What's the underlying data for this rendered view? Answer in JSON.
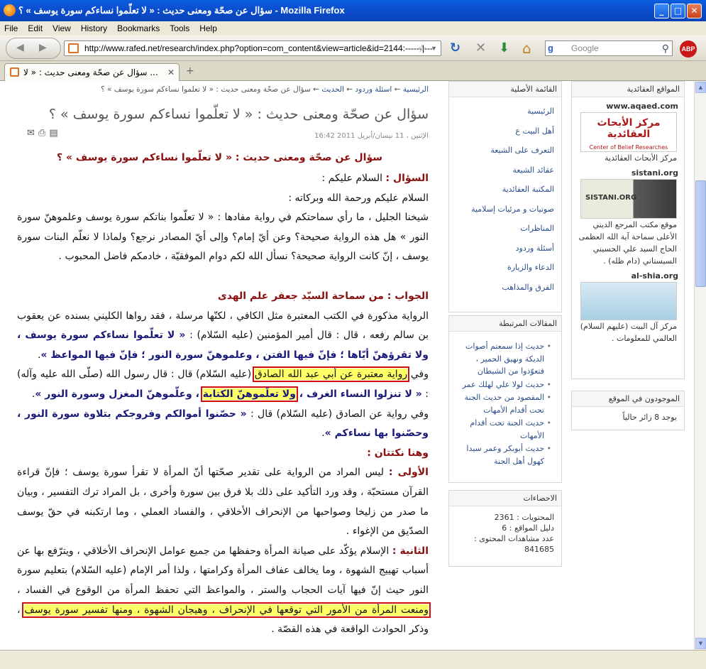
{
  "window": {
    "title": "سؤال عن صحّة ومعنى حديث : « لا تعلّموا نساءكم سورة يوسف » ؟ - Mozilla Firefox",
    "minimize": "_",
    "maximize": "□",
    "close": "✕"
  },
  "menu": [
    "File",
    "Edit",
    "View",
    "History",
    "Bookmarks",
    "Tools",
    "Help"
  ],
  "toolbar": {
    "back_icon": "◀",
    "forward_icon": "▶",
    "url": "http://www.rafed.net/research/index.php?option=com_content&view=article&id=2144:------|---",
    "star_icon": "☆",
    "dropdown_icon": "▼",
    "reload_icon": "↻",
    "stop_icon": "✕",
    "download_icon": "⬇",
    "home_icon": "⌂",
    "search_engine_icon": "g",
    "search_placeholder": "Google",
    "search_icon": "⚲",
    "abp_label": "ABP"
  },
  "tabs": {
    "active_label": "سؤال عن صحّة ومعنى حديث : « لا ...",
    "close_icon": "✕",
    "new_tab_icon": "+"
  },
  "breadcrumb": {
    "home": "الرئيسية",
    "sep": " ← ",
    "c1": "اسئلة وردود",
    "c2": "الحديث",
    "current": "سؤال عن صحّة ومعنى حديث : « لا تعلّموا نساءكم سورة يوسف » ؟"
  },
  "article": {
    "title": "سؤال عن صحّة ومعنى حديث : « لا تعلّموا نساءكم سورة يوسف » ؟",
    "date": "الإثنين ، 11 نيسان/أبريل 2011 16:42",
    "email_icon": "✉",
    "print_icon": "⎙",
    "pdf_icon": "▤",
    "heading": "سؤال عن صحّة ومعنى حديث : « لا تعلّموا نساءكم سورة يوسف » ؟",
    "q_label": "السؤال :",
    "q_greeting": " السلام عليكم :",
    "q_greeting2": "السلام عليكم ورحمة الله وبركاته :",
    "q_body": "شيخنا الجليل ، ما رأي سماحتكم في رواية مفادها : « لا تعلّموا بناتكم سورة يوسف وعلموهنّ سورة النور » هل هذه الرواية صحيحة؟ وعن أيّ إمام؟ وإلى أيّ المصادر نرجع؟ ولماذا لا نعلّم البنات سورة يوسف ، إنّ كانت الرواية صحيحة؟ نسأل الله لكم دوام الموفقيّة ، خادمكم فاضل المحبوب .",
    "a_label": "الجواب : من سماحة السيّد جعفر علم الهدى",
    "p1a": "الرواية مذكورة في الكتب المعتبرة مثل الكافي ، لكنّها مرسلة ، فقد رواها الكليني بسنده عن يعقوب بن سالم رفعه ، قال : قال أمير المؤمنين (عليه السّلام) : ",
    "p1b": "« لا تعلّموا نساءكم سورة يوسف ، ولا تقرؤهنّ أيّاها ؛ فإنّ فيها الفتن ، وعلموهنّ سورة النور ؛ فإنّ فيها المواعظ »",
    "p1c": ".",
    "p2a": "وفي ",
    "p2hl": "رواية معتبرة عن أبي عبد الله الصادق",
    "p2b": " (عليه السّلام) قال : قال رسول الله (صلّى الله عليه وآله) : ",
    "p2c": "« لا تنزلوا النساء الغرف ، ",
    "p2hl2": "ولا تعلّموهنّ الكتابة",
    "p2d": " ، وعلّموهنّ المغزل وسورة النور »",
    "p2e": ".",
    "p3a": "وفي رواية عن الصادق (عليه السّلام) قال : ",
    "p3b": "« حصّنوا أموالكم وفروجكم بتلاوة سورة النور ، وحصّنوا بها نساءكم »",
    "p3c": ".",
    "points_label": "وهنا نكتتان :",
    "first_label": "الأولى :",
    "first_body": " ليس المراد من الرواية على تقدير صحّتها أنّ المرأة لا تقرأ سورة يوسف ؛ فإنّ قراءة القرآن مستحبّة ، وقد ورد التأكيد على ذلك بلا فرق بين سورة وأخرى ، بل المراد ترك التفسير ، وبيان ما صدر من زليخا وصواحبها من الإنحراف الأخلاقي ، والفساد العملي ، وما ارتكبنه في حقّ يوسف الصدّيق من الإغواء .",
    "second_label": "الثانية :",
    "second_body": " الإسلام يؤكّد على صيانة المرأة وحفظها من جميع عوامل الإنحراف الأخلاقي ، ويترّفع بها عن أسباب تهييج الشهوة ، وما يخالف عفاف المرأة وكرامتها ، ولذا أمر الإمام (عليه السّلام) بتعليم سورة النور حيث إنّ فيها آيات الحجاب والستر ، والمواعظ التي تحفظ المرأة من الوقوع في الفساد ، ",
    "second_hl": "ومنعت المرأة من الأمور التي توقعها في الإنحراف ، وهيجان الشهوة ، ومنها تفسير سورة يوسف",
    "second_end": " ، وذكر الحوادث الواقعة في هذه القصّة ."
  },
  "sidebar": {
    "main_menu_title": "القائمة الأصلية",
    "main_menu": [
      "الرئيسية",
      "أهل البيت ع",
      "التعرف على الشيعة",
      "عقائد الشيعة",
      "المكتبة العقائدية",
      "صوتيات و مرئيات إسلامية",
      "المناظرات",
      "أسئلة وردود",
      "الدعاء والزيارة",
      "الفرق والمذاهب"
    ],
    "related_title": "المقالات المرتبطة",
    "related": [
      "حديث إذا سمعتم أصوات الديكة ونهيق الحمير ، فتعوّذوا من الشيطان",
      "حديث لولا علي لهلك عمر",
      "المقصود من حديث الجنة تحت أقدام الأمهات",
      "حديث الجنة تحت أقدام الأمهات",
      "حديث أبوبكر وعمر سيدا كهول أهل الجنة"
    ],
    "stats_title": "الاحصاءات",
    "stats": [
      "المحتويات : 2361",
      "دليل المواقع : 6",
      "عدد مشاهدات المحتوى : 841685"
    ]
  },
  "sites": {
    "title": "المواقع العقائدية",
    "s1_name": "www.aqaed.com",
    "s1_logo": "مركز الأبحاث العقائدية",
    "s1_logo_en": "Center of Belief Researches",
    "s1_caption": "مركز الأبحاث العقائدية",
    "s2_name": "sistani.org",
    "s2_logo": "SISTANI.ORG",
    "s2_caption": "موقع مكتب المرجع الديني الأعلى سماحة آية الله العظمى الحاج السيد علي الحسيني السيستاني (دام ظله) .",
    "s3_name": "al-shia.org",
    "s3_caption": "مركز آل البيت (عليهم السلام) العالمي للمعلومات .",
    "online_title": "الموجودون في الموقع",
    "online": "يوجد 8 زائر حالياً"
  }
}
